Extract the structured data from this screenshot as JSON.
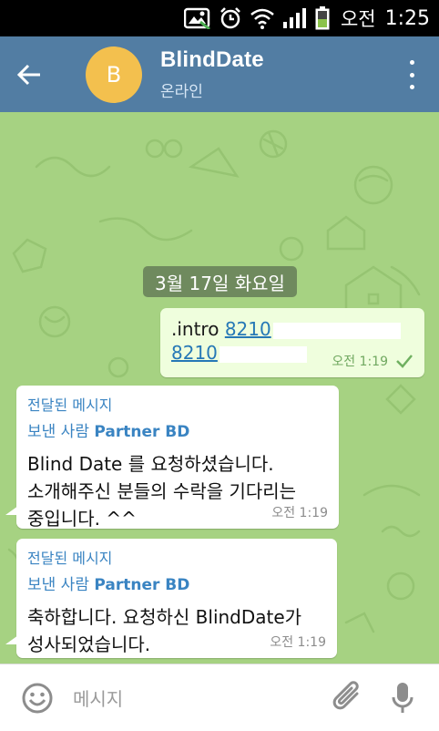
{
  "status_bar": {
    "ampm": "오전",
    "time": "1:25",
    "icons": [
      "gallery-icon",
      "alarm-icon",
      "wifi-icon",
      "signal-icon",
      "battery-icon"
    ]
  },
  "header": {
    "avatar_letter": "B",
    "title": "BlindDate",
    "status": "온라인",
    "colors": {
      "header_bg": "#527da3",
      "avatar_bg": "#f3c04e"
    }
  },
  "chat": {
    "date_label": "3월 17일 화요일",
    "outgoing": {
      "prefix": ".intro ",
      "link_line1": "8210",
      "link_line2": "8210",
      "time": "오전 1:19",
      "status_icon": "check-icon"
    },
    "incoming": [
      {
        "forward_label": "전달된 메시지",
        "from_prefix": "보낸 사람 ",
        "from_name": "Partner BD",
        "line1": "Blind Date 를 요청하셨습니다.",
        "line2": "소개해주신 분들의 수락을 기다리는",
        "line3": "중입니다. ^^",
        "time": "오전 1:19"
      },
      {
        "forward_label": "전달된 메시지",
        "from_prefix": "보낸 사람 ",
        "from_name": "Partner BD",
        "line1": "축하합니다. 요청하신 BlindDate가",
        "line2": "성사되었습니다.",
        "time": "오전 1:19"
      }
    ],
    "colors": {
      "background": "#a6d282",
      "outgoing_bubble": "#effedd",
      "link": "#2678b6",
      "forward": "#3a84c2"
    }
  },
  "input_bar": {
    "placeholder": "메시지",
    "icons": [
      "emoji-icon",
      "attach-icon",
      "mic-icon"
    ]
  }
}
